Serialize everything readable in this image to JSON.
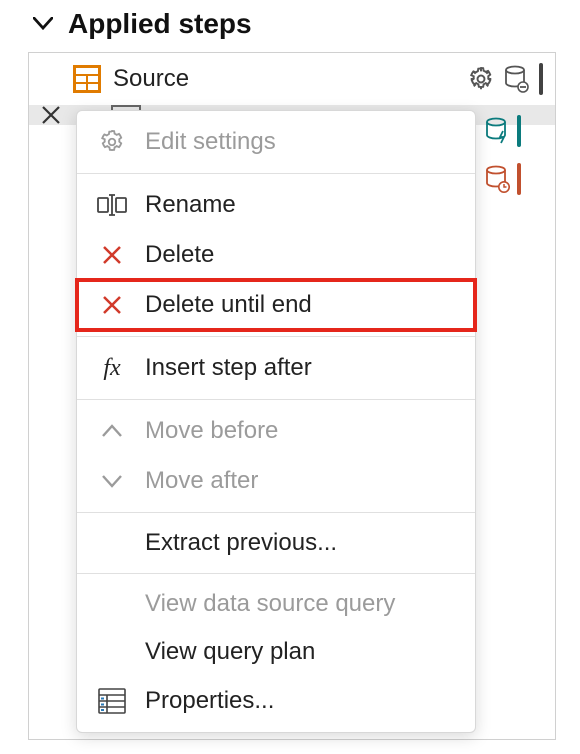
{
  "header": {
    "title": "Applied steps"
  },
  "steps": [
    {
      "label": "Source"
    }
  ],
  "indicators": {
    "c0": "#424242",
    "c1": "#0b7b7d",
    "c2": "#c1502e"
  },
  "contextMenu": {
    "editSettings": "Edit settings",
    "rename": "Rename",
    "delete": "Delete",
    "deleteUntilEnd": "Delete until end",
    "insertStepAfter": "Insert step after",
    "moveBefore": "Move before",
    "moveAfter": "Move after",
    "extractPrevious": "Extract previous...",
    "viewDataSourceQuery": "View data source query",
    "viewQueryPlan": "View query plan",
    "properties": "Properties..."
  }
}
